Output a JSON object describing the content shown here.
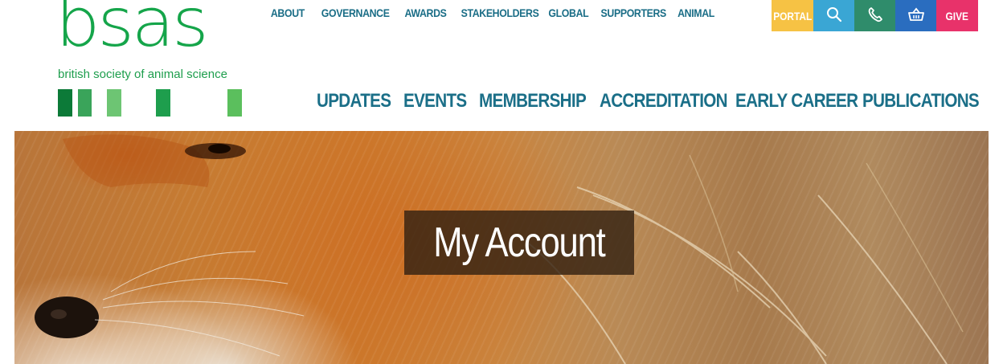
{
  "logo": {
    "wordmark": "bsas",
    "tagline": "british society of animal science",
    "colors": [
      "#0c7a38",
      "#3aa45a",
      "#6dc573",
      "#1e9e4d",
      "#5bbf5d"
    ]
  },
  "top_nav": [
    "ABOUT",
    "GOVERNANCE",
    "AWARDS",
    "STAKEHOLDERS",
    "GLOBAL",
    "SUPPORTERS",
    "ANIMAL"
  ],
  "utility": {
    "portal": {
      "label": "PORTAL",
      "color": "#f6c244"
    },
    "search": {
      "icon": "search-icon",
      "color": "#3aa6d4"
    },
    "phone": {
      "icon": "phone-icon",
      "color": "#2f8c6b"
    },
    "basket": {
      "icon": "basket-icon",
      "color": "#2a6dbf"
    },
    "give": {
      "label": "GIVE",
      "color": "#e8326a"
    }
  },
  "main_nav": [
    "UPDATES",
    "EVENTS",
    "MEMBERSHIP",
    "ACCREDITATION",
    "EARLY CAREER",
    "PUBLICATIONS"
  ],
  "hero": {
    "title": "My Account"
  }
}
